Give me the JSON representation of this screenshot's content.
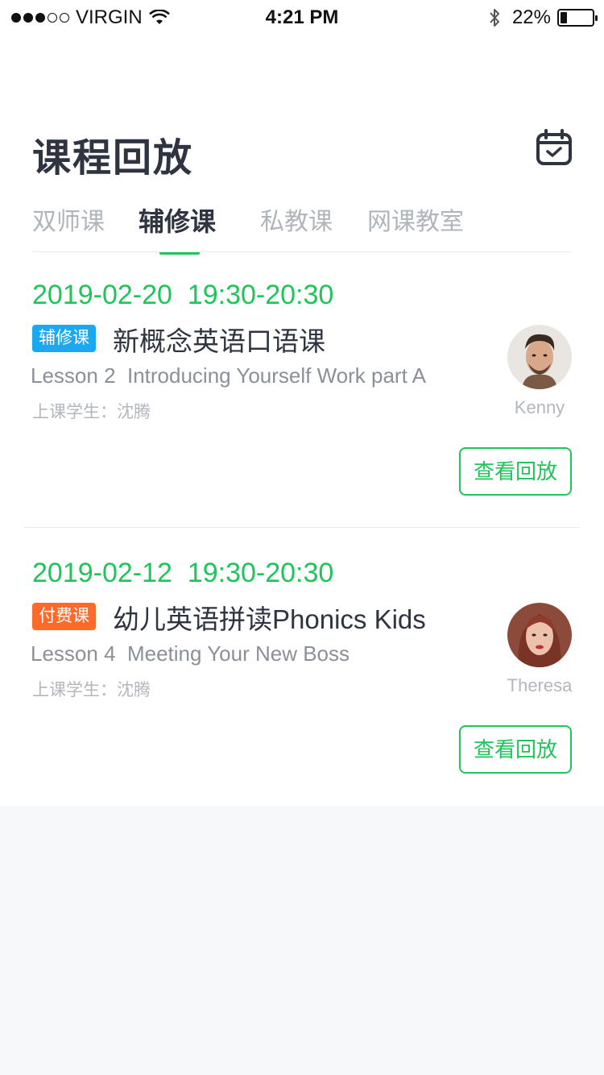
{
  "status_bar": {
    "carrier": "VIRGIN",
    "time": "4:21 PM",
    "battery_percent_text": "22%",
    "battery_level": 0.22
  },
  "header": {
    "title": "课程回放",
    "calendar_icon": "calendar-check-icon"
  },
  "tabs": [
    {
      "label": "双师课",
      "active": false
    },
    {
      "label": "辅修课",
      "active": true
    },
    {
      "label": "私教课",
      "active": false
    },
    {
      "label": "网课教室",
      "active": false
    }
  ],
  "cards": [
    {
      "date": "2019-02-20  19:30-20:30",
      "badge": {
        "label": "辅修课",
        "color": "#1aa8f0"
      },
      "course_title": "新概念英语口语课",
      "lesson": "Lesson 2  Introducing Yourself Work part A",
      "student": "上课学生：沈腾",
      "teacher_name": "Kenny",
      "button_label": "查看回放"
    },
    {
      "date": "2019-02-12  19:30-20:30",
      "badge": {
        "label": "付费课",
        "color": "#ff6a2b"
      },
      "course_title": "幼儿英语拼读Phonics Kids",
      "lesson": "Lesson 4  Meeting Your New Boss",
      "student": "上课学生：沈腾",
      "teacher_name": "Theresa",
      "button_label": "查看回放"
    }
  ],
  "colors": {
    "accent_green": "#1fc45a",
    "title_dark": "#2e3440",
    "tab_inactive": "#b0b4bb",
    "background": "#f7f8fa"
  }
}
